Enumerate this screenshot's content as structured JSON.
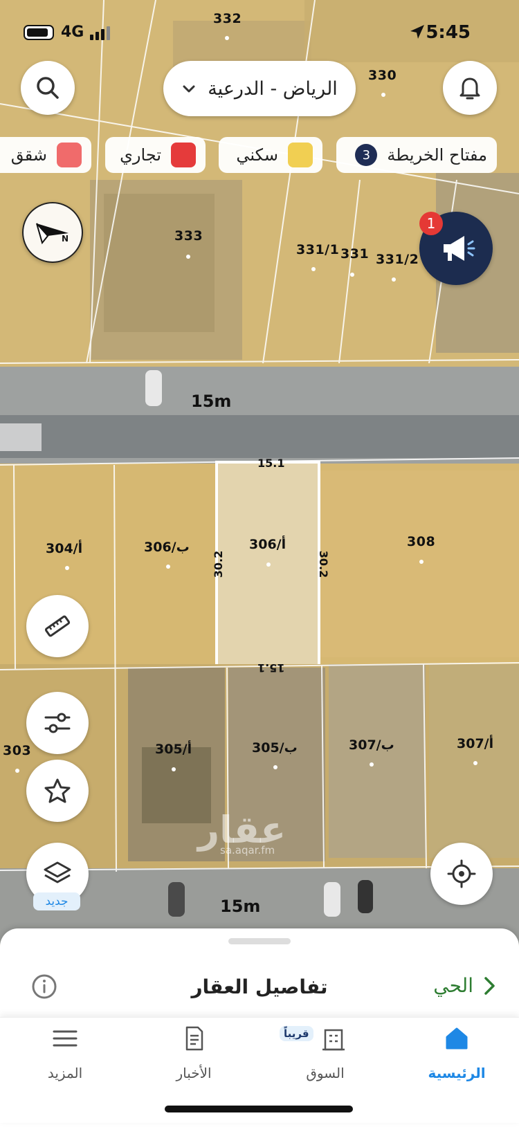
{
  "status_bar": {
    "network": "4G",
    "time": "5:45"
  },
  "header": {
    "city_selector": "الرياض - الدرعية",
    "dropdown_icon": "chevron-down-icon",
    "search_icon": "search-icon",
    "bell_icon": "bell-icon"
  },
  "legend_chips": [
    {
      "label": "مفتاح الخريطة",
      "badge": "3",
      "color": "#1f2d55"
    },
    {
      "label": "سكني",
      "color": "#f1cf52"
    },
    {
      "label": "تجاري",
      "color": "#e53b3b"
    },
    {
      "label": "شقق",
      "color": "#f06b6b"
    }
  ],
  "announcement": {
    "badge": "1",
    "icon": "megaphone-icon"
  },
  "compass_icon": "compass-icon",
  "plots": [
    "332",
    "330",
    "333",
    "331/1",
    "331",
    "331/2",
    "304/أ",
    "306/ب",
    "306/أ",
    "308",
    "303",
    "305/أ",
    "305/ب",
    "307/ب",
    "307/أ"
  ],
  "roads": {
    "top": "15m",
    "bottom": "15m"
  },
  "selected_plot_dims": {
    "top": "15.1",
    "bottom": "15.1",
    "left": "30.2",
    "right": "30.2"
  },
  "side_tools": [
    "ruler-icon",
    "filter-sliders-icon",
    "star-icon",
    "layers-icon"
  ],
  "layers_new_badge": "جديد",
  "locate_icon": "crosshair-icon",
  "watermark": {
    "text": "عقار",
    "url": "sa.aqar.fm"
  },
  "sheet": {
    "title": "تفاصيل العقار",
    "neighborhood_link": "الحي",
    "info_icon": "info-icon"
  },
  "tabs": [
    {
      "label": "الرئيسية",
      "icon": "home-icon",
      "active": true
    },
    {
      "label": "السوق",
      "icon": "building-icon",
      "badge": "قريباً"
    },
    {
      "label": "الأخبار",
      "icon": "news-icon"
    },
    {
      "label": "المزيد",
      "icon": "menu-icon"
    }
  ],
  "colors": {
    "accent_blue": "#1e88e5",
    "green": "#2e7d32",
    "navy": "#1f2d55"
  }
}
